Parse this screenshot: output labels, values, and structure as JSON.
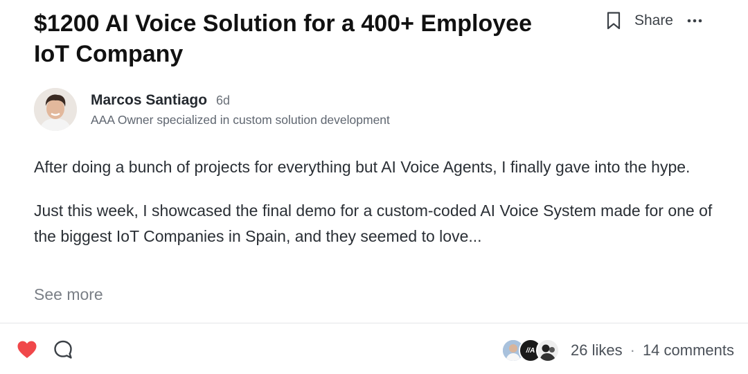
{
  "post": {
    "title": "$1200 AI Voice Solution for a 400+ Employee IoT Company",
    "author": {
      "name": "Marcos Santiago",
      "age": "6d",
      "headline": "AAA Owner specialized in custom solution development"
    },
    "paragraphs": [
      "After doing a bunch of projects for everything but AI Voice Agents, I finally gave into the hype.",
      "Just this week, I showcased the final demo for a custom-coded AI Voice System made for one of the biggest IoT Companies in Spain, and they seemed to love..."
    ],
    "see_more": "See more"
  },
  "actions": {
    "bookmark_icon": "bookmark-icon",
    "share_label": "Share",
    "more_icon": "ellipsis-icon"
  },
  "footer": {
    "likes": "26 likes",
    "separator": "·",
    "comments": "14 comments",
    "like_avatar_badge": "//A"
  },
  "colors": {
    "heart": "#f0474a",
    "text": "#2a2f35",
    "muted": "#7a7f86"
  }
}
